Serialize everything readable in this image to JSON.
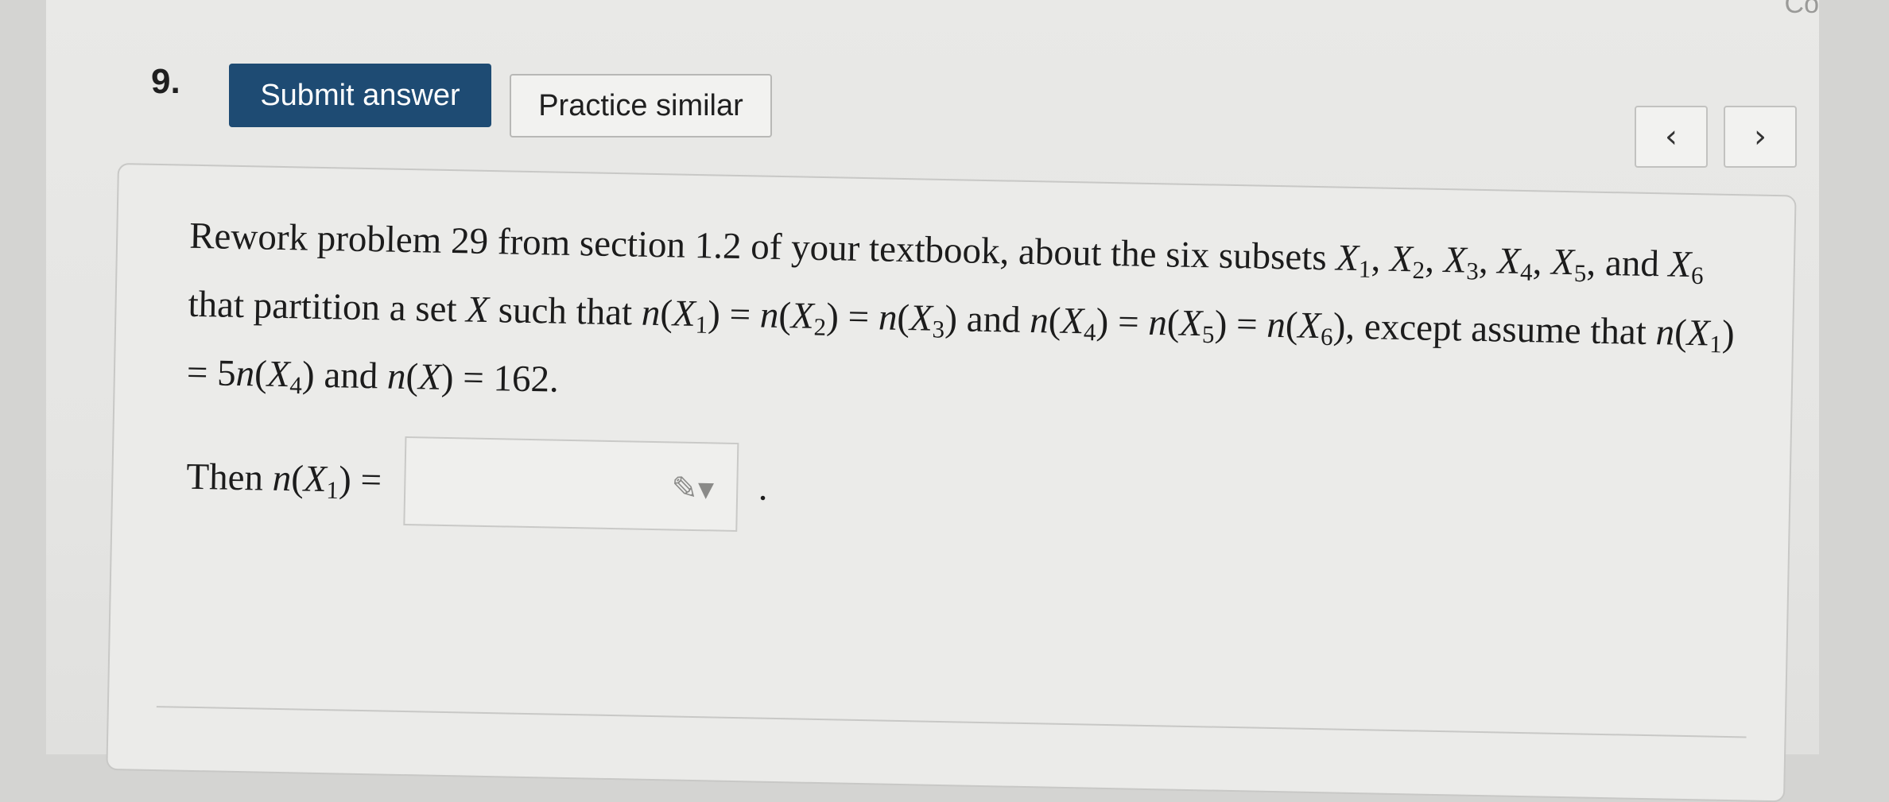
{
  "corner_text": "Co",
  "question": {
    "number": "9.",
    "submit_label": "Submit answer",
    "practice_label": "Practice similar"
  },
  "nav": {
    "prev_glyph": "‹",
    "next_glyph": "›"
  },
  "problem": {
    "text": "Rework problem 29 from section 1.2 of your textbook, about the six subsets X1, X2, X3, X4, X5, and X6 that partition a set X such that n(X1) = n(X2) = n(X3) and n(X4) = n(X5) = n(X6), except assume that n(X1) = 5n(X4) and n(X) = 162.",
    "answer_prefix": "Then n(X1) =",
    "answer_value": "",
    "answer_suffix": "."
  },
  "icons": {
    "answer_tool": "pencil-dropdown-icon"
  }
}
